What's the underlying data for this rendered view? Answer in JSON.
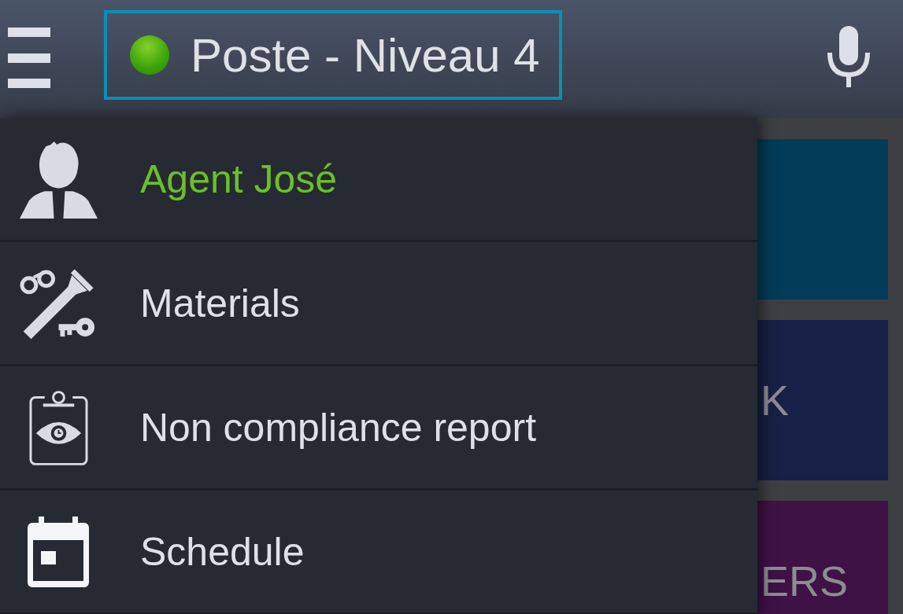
{
  "top_bar": {
    "title": "Poste - Niveau 4",
    "connected": true,
    "focused": true
  },
  "drawer": {
    "items": [
      {
        "kind": "profile",
        "label": "Agent José"
      },
      {
        "kind": "link",
        "label": "Materials"
      },
      {
        "kind": "link",
        "label": "Non compliance report"
      },
      {
        "kind": "link",
        "label": "Schedule"
      }
    ]
  },
  "dashboard": {
    "tiles": [
      {
        "color": "#023c58"
      },
      {
        "label": "K",
        "color": "#182047"
      },
      {
        "label": "ERS",
        "color": "#3e1245"
      }
    ]
  }
}
